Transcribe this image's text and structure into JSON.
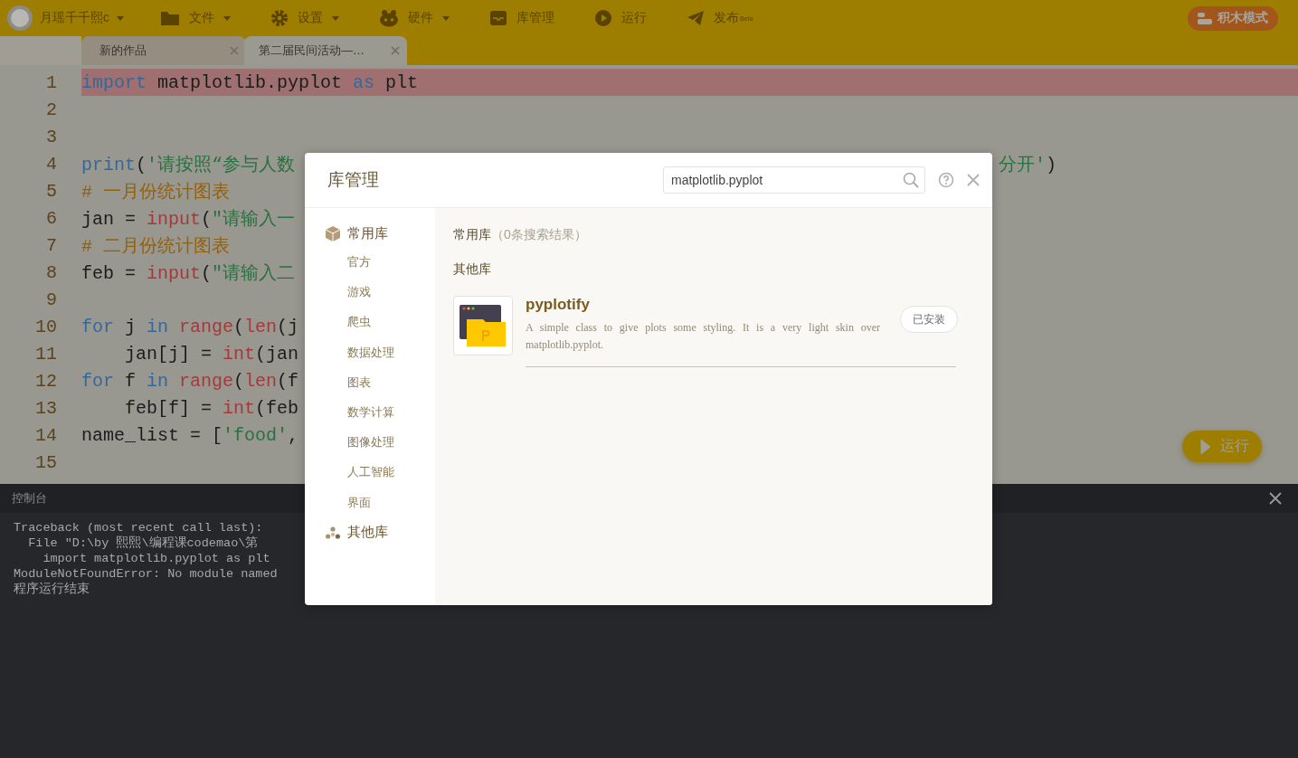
{
  "user": {
    "name": "月瑶千千熙c"
  },
  "menu": [
    {
      "label": "文件",
      "dropdown": true
    },
    {
      "label": "设置",
      "dropdown": true
    },
    {
      "label": "硬件",
      "dropdown": true
    },
    {
      "label": "库管理",
      "dropdown": false
    },
    {
      "label": "运行",
      "dropdown": false
    },
    {
      "label": "发布",
      "badge": "Beta",
      "dropdown": false
    }
  ],
  "mode_button": {
    "label": "积木模式"
  },
  "tabs": [
    {
      "label": "新的作品",
      "selected": false
    },
    {
      "label": "第二届民间活动—…",
      "selected": true
    }
  ],
  "editor": {
    "lines": [
      {
        "number": "1",
        "highlighted": true,
        "tokens": [
          {
            "kind": "keyword",
            "text": "import"
          },
          {
            "kind": "plain",
            "text": " matplotlib.pyplot "
          },
          {
            "kind": "keyword",
            "text": "as"
          },
          {
            "kind": "plain",
            "text": " plt"
          }
        ]
      },
      {
        "number": "2",
        "highlighted": false
      },
      {
        "number": "3",
        "highlighted": false
      },
      {
        "number": "4",
        "highlighted": false,
        "tokens": [
          {
            "kind": "keyword",
            "text": "print"
          },
          {
            "kind": "plain",
            "text": "("
          },
          {
            "kind": "string",
            "text": "'请按照“参与人数"
          }
        ],
        "tail": [
          {
            "kind": "string",
            "text": "分开'"
          },
          {
            "kind": "plain",
            "text": ")"
          }
        ]
      },
      {
        "number": "5",
        "highlighted": false,
        "tokens": [
          {
            "kind": "comment",
            "text": "# 一月份统计图表"
          }
        ]
      },
      {
        "number": "6",
        "highlighted": false,
        "tokens": [
          {
            "kind": "plain",
            "text": "jan = "
          },
          {
            "kind": "builtin",
            "text": "input"
          },
          {
            "kind": "plain",
            "text": "("
          },
          {
            "kind": "string",
            "text": "\"请输入一"
          }
        ]
      },
      {
        "number": "7",
        "highlighted": false,
        "tokens": [
          {
            "kind": "comment",
            "text": "# 二月份统计图表"
          }
        ]
      },
      {
        "number": "8",
        "highlighted": false,
        "tokens": [
          {
            "kind": "plain",
            "text": "feb = "
          },
          {
            "kind": "builtin",
            "text": "input"
          },
          {
            "kind": "plain",
            "text": "("
          },
          {
            "kind": "string",
            "text": "\"请输入二"
          }
        ]
      },
      {
        "number": "9",
        "highlighted": false
      },
      {
        "number": "10",
        "highlighted": false,
        "tokens": [
          {
            "kind": "keyword",
            "text": "for"
          },
          {
            "kind": "plain",
            "text": " j "
          },
          {
            "kind": "keyword",
            "text": "in "
          },
          {
            "kind": "builtin",
            "text": "range"
          },
          {
            "kind": "plain",
            "text": "("
          },
          {
            "kind": "builtin",
            "text": "len"
          },
          {
            "kind": "plain",
            "text": "(j"
          }
        ]
      },
      {
        "number": "11",
        "highlighted": false,
        "tokens": [
          {
            "kind": "plain",
            "text": "    jan[j] = "
          },
          {
            "kind": "builtin",
            "text": "int"
          },
          {
            "kind": "plain",
            "text": "(jan"
          }
        ]
      },
      {
        "number": "12",
        "highlighted": false,
        "tokens": [
          {
            "kind": "keyword",
            "text": "for"
          },
          {
            "kind": "plain",
            "text": " f "
          },
          {
            "kind": "keyword",
            "text": "in "
          },
          {
            "kind": "builtin",
            "text": "range"
          },
          {
            "kind": "plain",
            "text": "("
          },
          {
            "kind": "builtin",
            "text": "len"
          },
          {
            "kind": "plain",
            "text": "(f"
          }
        ]
      },
      {
        "number": "13",
        "highlighted": false,
        "tokens": [
          {
            "kind": "plain",
            "text": "    feb[f] = "
          },
          {
            "kind": "builtin",
            "text": "int"
          },
          {
            "kind": "plain",
            "text": "(feb"
          }
        ]
      },
      {
        "number": "14",
        "highlighted": false,
        "tokens": [
          {
            "kind": "plain",
            "text": "name_list = ["
          },
          {
            "kind": "string",
            "text": "'food'"
          },
          {
            "kind": "plain",
            "text": ","
          }
        ]
      },
      {
        "number": "15",
        "highlighted": false
      }
    ]
  },
  "run_button": {
    "label": "运行"
  },
  "console": {
    "title": "控制台",
    "lines": [
      "Traceback (most recent call last):",
      "  File \"D:\\by 熙熙\\编程课codemao\\第",
      "    import matplotlib.pyplot as plt",
      "ModuleNotFoundError: No module named",
      "程序运行结束"
    ]
  },
  "modal": {
    "title": "库管理",
    "search": {
      "value": "matplotlib.pyplot"
    },
    "sidebar": [
      {
        "label": "常用库",
        "children": [
          {
            "label": "官方"
          },
          {
            "label": "游戏"
          },
          {
            "label": "爬虫"
          },
          {
            "label": "数据处理"
          },
          {
            "label": "图表"
          },
          {
            "label": "数学计算"
          },
          {
            "label": "图像处理"
          },
          {
            "label": "人工智能"
          },
          {
            "label": "界面"
          }
        ]
      },
      {
        "label": "其他库"
      }
    ],
    "results": {
      "heading": "常用库",
      "count": "（0条搜索结果）",
      "other_heading": "其他库",
      "packages": [
        {
          "name": "pyplotify",
          "description": "A simple class to give plots some styling. It is a very light skin over matplotlib.pyplot.",
          "status": "已安装"
        }
      ]
    }
  }
}
